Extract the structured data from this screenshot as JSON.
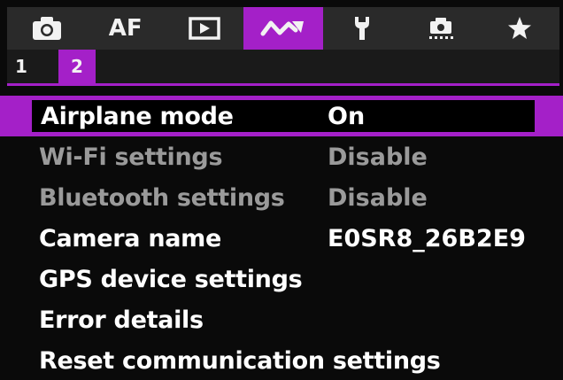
{
  "tabs": [
    {
      "label": "",
      "icon": "camera-icon",
      "active": false
    },
    {
      "label": "AF",
      "icon": "",
      "active": false
    },
    {
      "label": "",
      "icon": "playback-icon",
      "active": false
    },
    {
      "label": "",
      "icon": "wireless-icon",
      "active": true
    },
    {
      "label": "",
      "icon": "wrench-icon",
      "active": false
    },
    {
      "label": "",
      "icon": "custom-function-icon",
      "active": false
    },
    {
      "label": "",
      "icon": "star-icon",
      "active": false
    }
  ],
  "pages": [
    {
      "label": "1",
      "active": false
    },
    {
      "label": "2",
      "active": true
    }
  ],
  "menu": {
    "items": [
      {
        "label": "Airplane mode",
        "value": "On",
        "state": "selected"
      },
      {
        "label": "Wi-Fi settings",
        "value": "Disable",
        "state": "disabled"
      },
      {
        "label": "Bluetooth settings",
        "value": "Disable",
        "state": "disabled"
      },
      {
        "label": "Camera name",
        "value": "E0SR8_26B2E9",
        "state": "normal"
      },
      {
        "label": "GPS device settings",
        "value": "",
        "state": "normal"
      },
      {
        "label": "Error details",
        "value": "",
        "state": "normal"
      },
      {
        "label": "Reset communication settings",
        "value": "",
        "state": "normal"
      }
    ]
  },
  "colors": {
    "accent": "#a420c8",
    "tab_bar": "#2a2a2a",
    "text": "#ffffff",
    "disabled_text": "#9a9a9a"
  }
}
